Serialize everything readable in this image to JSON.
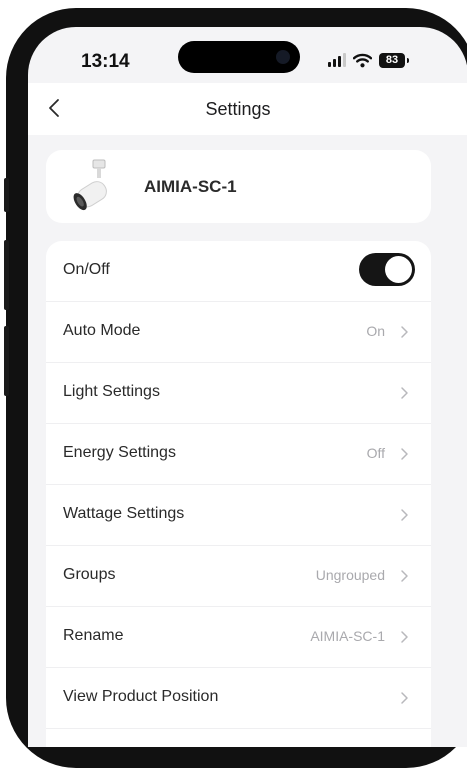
{
  "status_bar": {
    "time": "13:14",
    "battery": "83"
  },
  "nav": {
    "title": "Settings",
    "back_icon": "chevron-left-icon"
  },
  "device": {
    "name": "AIMIA-SC-1",
    "icon": "track-spotlight-icon"
  },
  "settings": {
    "on_off": {
      "label": "On/Off",
      "state": true
    },
    "rows": [
      {
        "label": "Auto Mode",
        "value": "On"
      },
      {
        "label": "Light Settings",
        "value": ""
      },
      {
        "label": "Energy Settings",
        "value": "Off"
      },
      {
        "label": "Wattage Settings",
        "value": ""
      },
      {
        "label": "Groups",
        "value": "Ungrouped"
      },
      {
        "label": "Rename",
        "value": "AIMIA-SC-1"
      },
      {
        "label": "View Product Position",
        "value": ""
      }
    ]
  },
  "colors": {
    "toggle_on": "#151515",
    "background": "#f4f4f6",
    "card": "#ffffff",
    "value_text": "#a9a9ad"
  }
}
